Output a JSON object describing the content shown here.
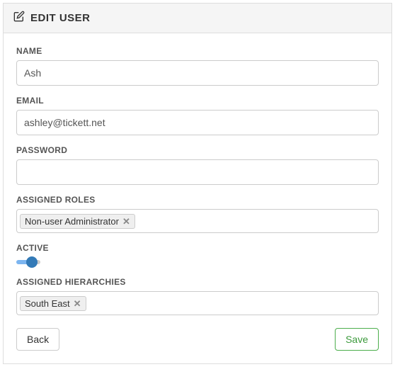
{
  "panel": {
    "title": "EDIT USER"
  },
  "fields": {
    "name": {
      "label": "NAME",
      "value": "Ash"
    },
    "email": {
      "label": "EMAIL",
      "value": "ashley@tickett.net"
    },
    "password": {
      "label": "PASSWORD",
      "value": ""
    },
    "roles": {
      "label": "ASSIGNED ROLES",
      "tags": [
        "Non-user Administrator"
      ]
    },
    "active": {
      "label": "ACTIVE",
      "value": true
    },
    "hierarchies": {
      "label": "ASSIGNED HIERARCHIES",
      "tags": [
        "South East"
      ]
    }
  },
  "buttons": {
    "back": "Back",
    "save": "Save"
  }
}
